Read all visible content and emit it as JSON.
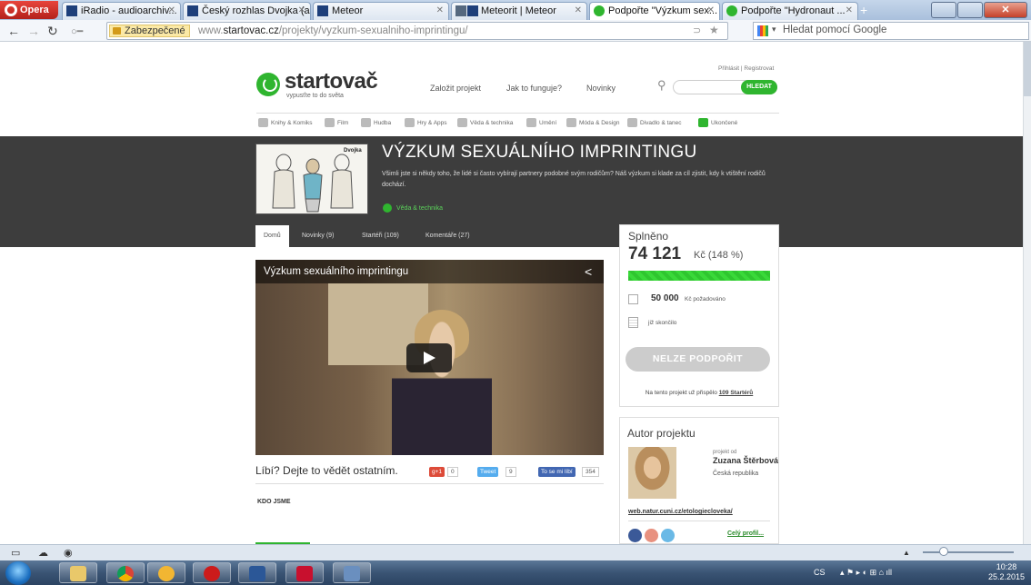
{
  "browser": {
    "opera_label": "Opera",
    "tabs": [
      {
        "label": "iRadio - audioarchiv..."
      },
      {
        "label": "Český rozhlas Dvojka (a..."
      },
      {
        "label": "Meteor"
      },
      {
        "label": "Meteorit | Meteor"
      },
      {
        "label": "Podpořte \"Výzkum sex..."
      },
      {
        "label": "Podpořte \"Hydronaut ..."
      }
    ],
    "secure_label": "Zabezpečené",
    "url_prefix": "www.",
    "url_domain": "startovac.cz",
    "url_path": "/projekty/vyzkum-sexualniho-imprintingu/",
    "search_placeholder": "Hledat pomocí Google"
  },
  "site": {
    "logo": "startovač",
    "tagline": "vypusťte to do světa",
    "login": "Přihlásit | Registrovat",
    "nav": [
      "Založit projekt",
      "Jak to funguje?",
      "Novinky"
    ],
    "search_button": "HLEDAT",
    "categories": [
      "Knihy & Komiks",
      "Film",
      "Hudba",
      "Hry & Apps",
      "Věda & technika",
      "Umění",
      "Móda & Design",
      "Divadlo & tanec",
      "Ukončené"
    ],
    "accent": "#2fb52f"
  },
  "project": {
    "thumb_brand": "Dvojka",
    "title": "VÝZKUM SEXUÁLNÍHO IMPRINTINGU",
    "description": "Všimli jste si někdy toho, že lidé si často vybírají partnery podobné svým rodičům? Náš výzkum si klade za cíl zjistit, kdy k vtištění rodičů dochází.",
    "category": "Věda & technika",
    "tabs": [
      "Domů",
      "Novinky (9)",
      "Startéři (109)",
      "Komentáře (27)"
    ],
    "video_title": "Výzkum sexuálního imprintingu",
    "like_prompt": "Líbí? Dejte to vědět ostatním.",
    "social": {
      "gplus": "g+1",
      "gplus_count": "0",
      "tweet": "Tweet",
      "tweet_count": "9",
      "fb": "To se mi líbí",
      "fb_count": "354"
    },
    "kdo": "KDO JSME"
  },
  "funding": {
    "label": "Splněno",
    "amount": "74 121",
    "amount_sub": "Kč (148 %)",
    "progress_percent": 100,
    "goal": "50 000",
    "goal_sub": "Kč požadováno",
    "ended": "již skončilo",
    "button": "NELZE PODPOŘIT",
    "contrib_prefix": "Na tento projekt už přispělo",
    "contrib_link": "109 Startérů"
  },
  "author": {
    "heading": "Autor projektu",
    "by": "projekt od",
    "name": "Zuzana Štěrbová",
    "country": "Česká republika",
    "url": "web.natur.cuni.cz/etologiecloveka/",
    "profile": "Celý profil..."
  },
  "taskbar": {
    "lang": "CS",
    "time": "10:28",
    "date": "25.2.2015"
  }
}
